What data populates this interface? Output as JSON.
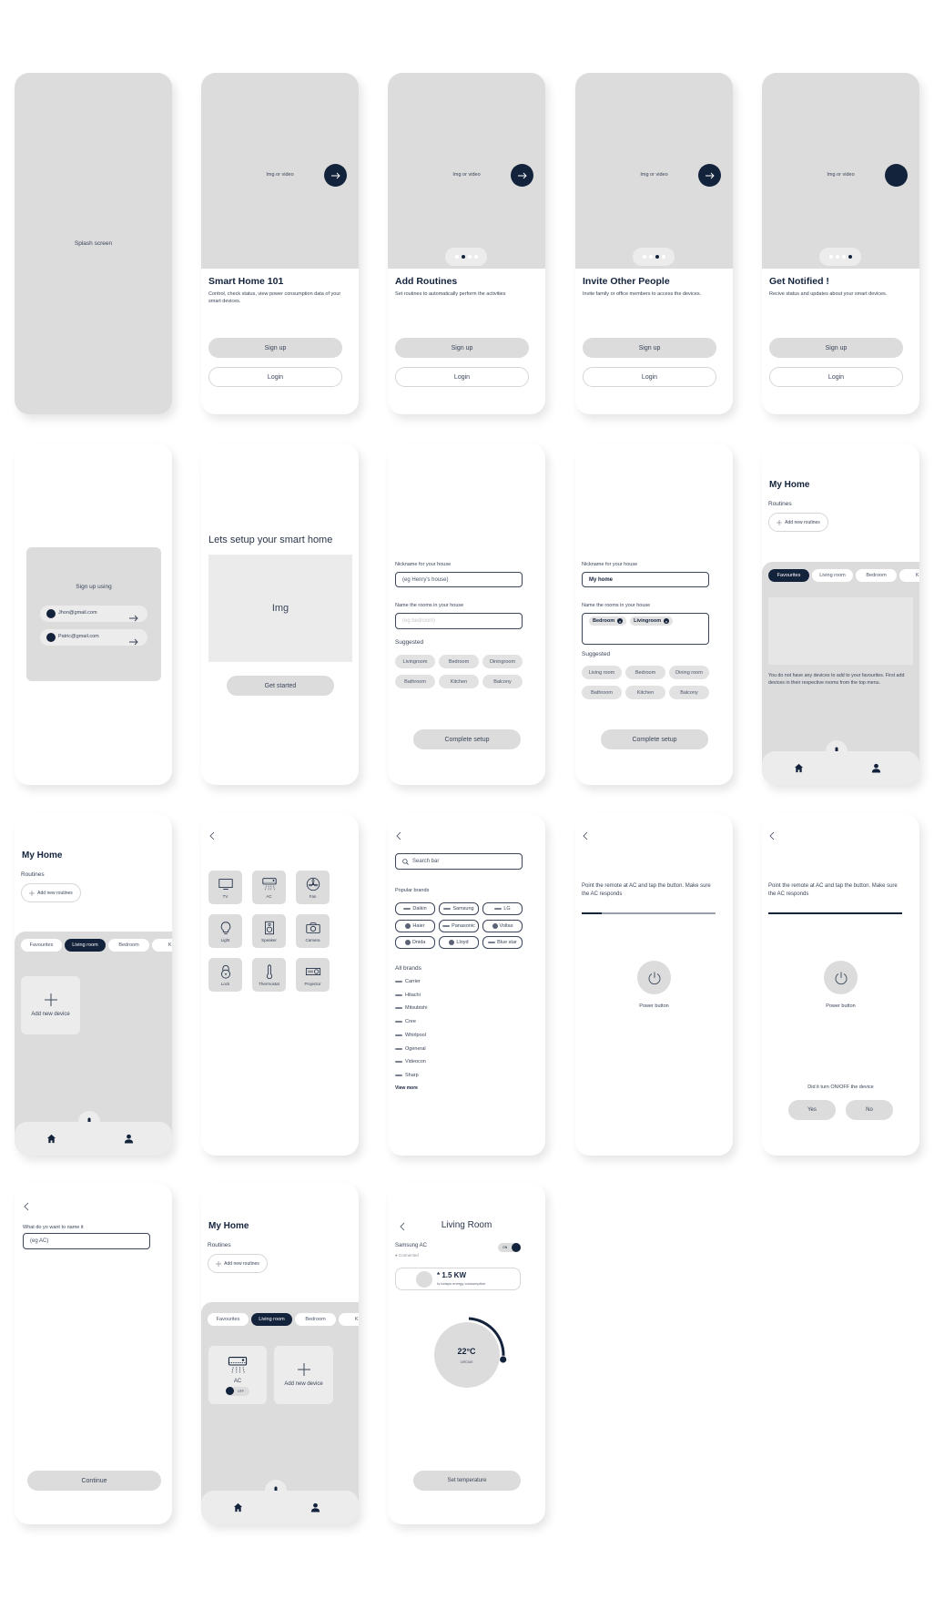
{
  "colors": {
    "accent": "#14233c",
    "placeholder": "#dcdcdc",
    "surface": "#ececec"
  },
  "splash": {
    "label": "Splash screen"
  },
  "onboarding": {
    "image_label": "Img or video",
    "signup": "Sign up",
    "login": "Login",
    "slides": [
      {
        "title": "Smart Home 101",
        "description": "Control, check status, view power consumption data of your smart devices.",
        "active_dot": null,
        "arrow_icon": "arrow-right-icon"
      },
      {
        "title": "Add Routines",
        "description": "Set routines to automatically perform the activities",
        "active_dot": 1,
        "arrow_icon": "arrow-right-icon"
      },
      {
        "title": "Invite Other People",
        "description": "Invite family or office members to access the devices.",
        "active_dot": 2,
        "arrow_icon": "arrow-right-icon"
      },
      {
        "title": "Get Notified !",
        "description": "Recive status and updates about your smart devices.",
        "active_dot": 3,
        "arrow_icon": null
      }
    ]
  },
  "signup_using": {
    "title": "Sign up using",
    "accounts": [
      "Jhon@gmail.com",
      "Patric@gmail.com"
    ]
  },
  "setup": {
    "title": "Lets setup your smart home",
    "image_label": "Img",
    "button": "Get started"
  },
  "house_form": {
    "nickname_label": "Nickname for your house",
    "nickname_placeholder": "(eg Henry's house)",
    "rooms_label": "Name the rooms in your house",
    "rooms_placeholder": "(eg bedroom)",
    "suggested_label": "Suggested",
    "suggestions": [
      "Livingroom",
      "Bedroom",
      "Diningroom",
      "Bathroom",
      "Kitchen",
      "Balcony"
    ],
    "button": "Complete setup"
  },
  "house_form_filled": {
    "nickname_value": "My home",
    "rooms": [
      "Bedroom",
      "Livingroom"
    ],
    "suggestions": [
      "Living room",
      "Bedroom",
      "Dining room",
      "Bathroom",
      "Kitchen",
      "Balcony"
    ]
  },
  "home": {
    "title": "My Home",
    "routines_label": "Routines",
    "add_routine": "Add new routines",
    "tabs": [
      "Favourites",
      "Living room",
      "Bedroom",
      "Kitc"
    ],
    "empty_message": "You do not have any devices to add to your favourites. First add devices in their respective rooms from the top menu.",
    "add_device": "Add new device",
    "device_name": "AC",
    "device_toggle": "OFF"
  },
  "device_types": [
    {
      "label": "TV",
      "icon": "tv-icon"
    },
    {
      "label": "AC",
      "icon": "ac-icon"
    },
    {
      "label": "Fan",
      "icon": "fan-icon"
    },
    {
      "label": "Light",
      "icon": "bulb-icon"
    },
    {
      "label": "Speaker",
      "icon": "speaker-icon"
    },
    {
      "label": "Camera",
      "icon": "camera-icon"
    },
    {
      "label": "Lock",
      "icon": "lock-icon"
    },
    {
      "label": "Thermostat",
      "icon": "thermometer-icon"
    },
    {
      "label": "Projector",
      "icon": "projector-icon"
    }
  ],
  "brands": {
    "search_placeholder": "Search bar",
    "popular_label": "Popular brands",
    "popular": [
      "Daikin",
      "Samsung",
      "LG",
      "Haier",
      "Panasonic",
      "Voltas",
      "Onida",
      "Lloyd",
      "Blue star"
    ],
    "all_label": "All brands",
    "all": [
      "Carrier",
      "Hitachi",
      "Mitsubishi",
      "Cree",
      "Whirlpool",
      "Ogeneral",
      "Videocon",
      "Sharp"
    ],
    "view_more": "View more"
  },
  "pairing": {
    "instruction": "Point the remote at AC and tap the button. Make sure the AC responds",
    "power_label": "Power button",
    "progress_step1": 0.15,
    "progress_step2": 1.0,
    "question": "Did it turn ON/OFF the device",
    "yes": "Yes",
    "no": "No"
  },
  "naming": {
    "label": "What do yo want to name it",
    "placeholder": "(eg AC)",
    "button": "Continue"
  },
  "room_detail": {
    "title": "Living Room",
    "device": "Samsung AC",
    "status": "Connected",
    "toggle": "ON",
    "energy_value": "* 1.5 KW",
    "energy_caption": "Is todays energy consumption",
    "temperature": "22°C",
    "unit": "celcius",
    "temperature_dial_fraction": 0.27,
    "button": "Set temperature"
  }
}
